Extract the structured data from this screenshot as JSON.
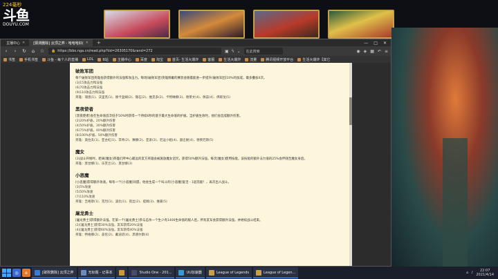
{
  "stream": {
    "viewer_count": "224毫秒",
    "logo_text": "斗鱼",
    "logo_sub": "DOUYU.COM"
  },
  "browser": {
    "tabs": [
      {
        "label": "主播中心",
        "active": false
      },
      {
        "label": "[猜测删除] 云顶之弈 - 哈哈哈好(",
        "active": true
      }
    ],
    "new_tab": "+",
    "window_controls": [
      "—",
      "□",
      "✕"
    ],
    "url": "https://bbs.nga.cn/read.php?tid=26305170&rand=272",
    "search_placeholder": "在此搜索",
    "bookmarks": [
      "书签",
      "手机书签",
      "斗鱼 - 每个人的直播",
      "LOL",
      "B站",
      "主播中心",
      "百度",
      "淘宝",
      "首页- 生活大爆炸",
      "客服",
      "生活大爆炸",
      "流量",
      "腾讯视频开放平台",
      "生活大爆炸【其它"
    ]
  },
  "article": {
    "sections": [
      {
        "title": "破败军团",
        "body": "每个破败军团英雄会获得额外的法强和攻击力。每场[破败军团]英雄佩戴的赛装会随着能进一步提升[破败军团]10%的加成，最多叠加4次。",
        "items": [
          "(3)15攻击力和法强",
          "(6)70攻击力和法强",
          "(9)110攻击力和法强"
        ],
        "heroes": "英雄：瑞恩(1)、沃里克(1)、赫卡里姆(2)、锤石(2)、维克多(2)、卡特琳娜(3)、德莱文(4)、佩兹(4)、佛耶戈(5)"
      },
      {
        "title": "黑夜使者",
        "body": "[黑夜使者]会在生命值首次低于50%时获得一个持续6秒的基于最大生命值的护盾。当护盾生效时，他们会造成额外伤害。",
        "items": [
          "(2)20%护盾，20%额外伤害",
          "(4)50%护盾，30%额外伤害",
          "(6)75%护盾，40%额外伤害",
          "(8)100%护盾，50%额外伤害"
        ],
        "heroes": "英雄：奥拉夫(1)、亚古虹(1)、李青(2)、赛娜(2)、亚索(2)、厄运小姐(4)、瑟庄妮(4)、德莱厄斯(5)"
      },
      {
        "title": "魔女",
        "body": "(3)战斗开始时，距离[魔女]英雄们所中心最远的友方英雄会被施放魔女诅咒，获得50%额外法强，每次[魔女]使用技能，该技能的额外法力值的25%会伴随至魔女身后。",
        "items": [],
        "heroes": "英雄：莫甘娜(1)、乐芙兰(2)、莫甘娜(3)"
      },
      {
        "title": "小恶魔",
        "body": "[小恶魔]获得额外攻速。每有一个[小恶魔]同盟，他会生成一个叫斗的[小恶魔]复活 - 1层充能！，再次出人战斗。",
        "items": [
          "(3)5%攻速",
          "(5)50%攻速",
          "(7)110%攻速"
        ],
        "heroes": "英雄：吉格斯(1)、克烈(1)、波比(1)、崔丝(2)、提姆(3)、维嘉(5)"
      },
      {
        "title": "屠龙勇士",
        "body": "[屠龙勇士]获得额外法强。在第一个[屠龙勇士]参与击杀一个生少有1400生命值的敌人后，所有友军会获得额外法强，并继续战斗结束。",
        "items": [
          "(2)[屠龙勇士]获得30%法强，友军获得20%法强",
          "(4)[屠龙勇士]获得60%法强，友军获得40%法强"
        ],
        "heroes": "英雄：特格娜(2)、盖伦(2)、戴迪诺(4)、黑德尔斯(4)"
      }
    ]
  },
  "taskbar": {
    "items": [
      {
        "label": "[破败删除] 云顶之弈",
        "color": "#3a7ad0"
      },
      {
        "label": "无标题 - 记事本",
        "color": "#6a8ac0"
      },
      {
        "label": "",
        "color": "#cc9933"
      },
      {
        "label": "Studio One - 201...",
        "color": "#4a4a6a"
      },
      {
        "label": "UU加速器",
        "color": "#3a9ad0"
      },
      {
        "label": "League of Legends",
        "color": "#c8a04a"
      },
      {
        "label": "League of Legen...",
        "color": "#c8a04a"
      }
    ],
    "time": "22:07",
    "date": "2021/4/14"
  }
}
